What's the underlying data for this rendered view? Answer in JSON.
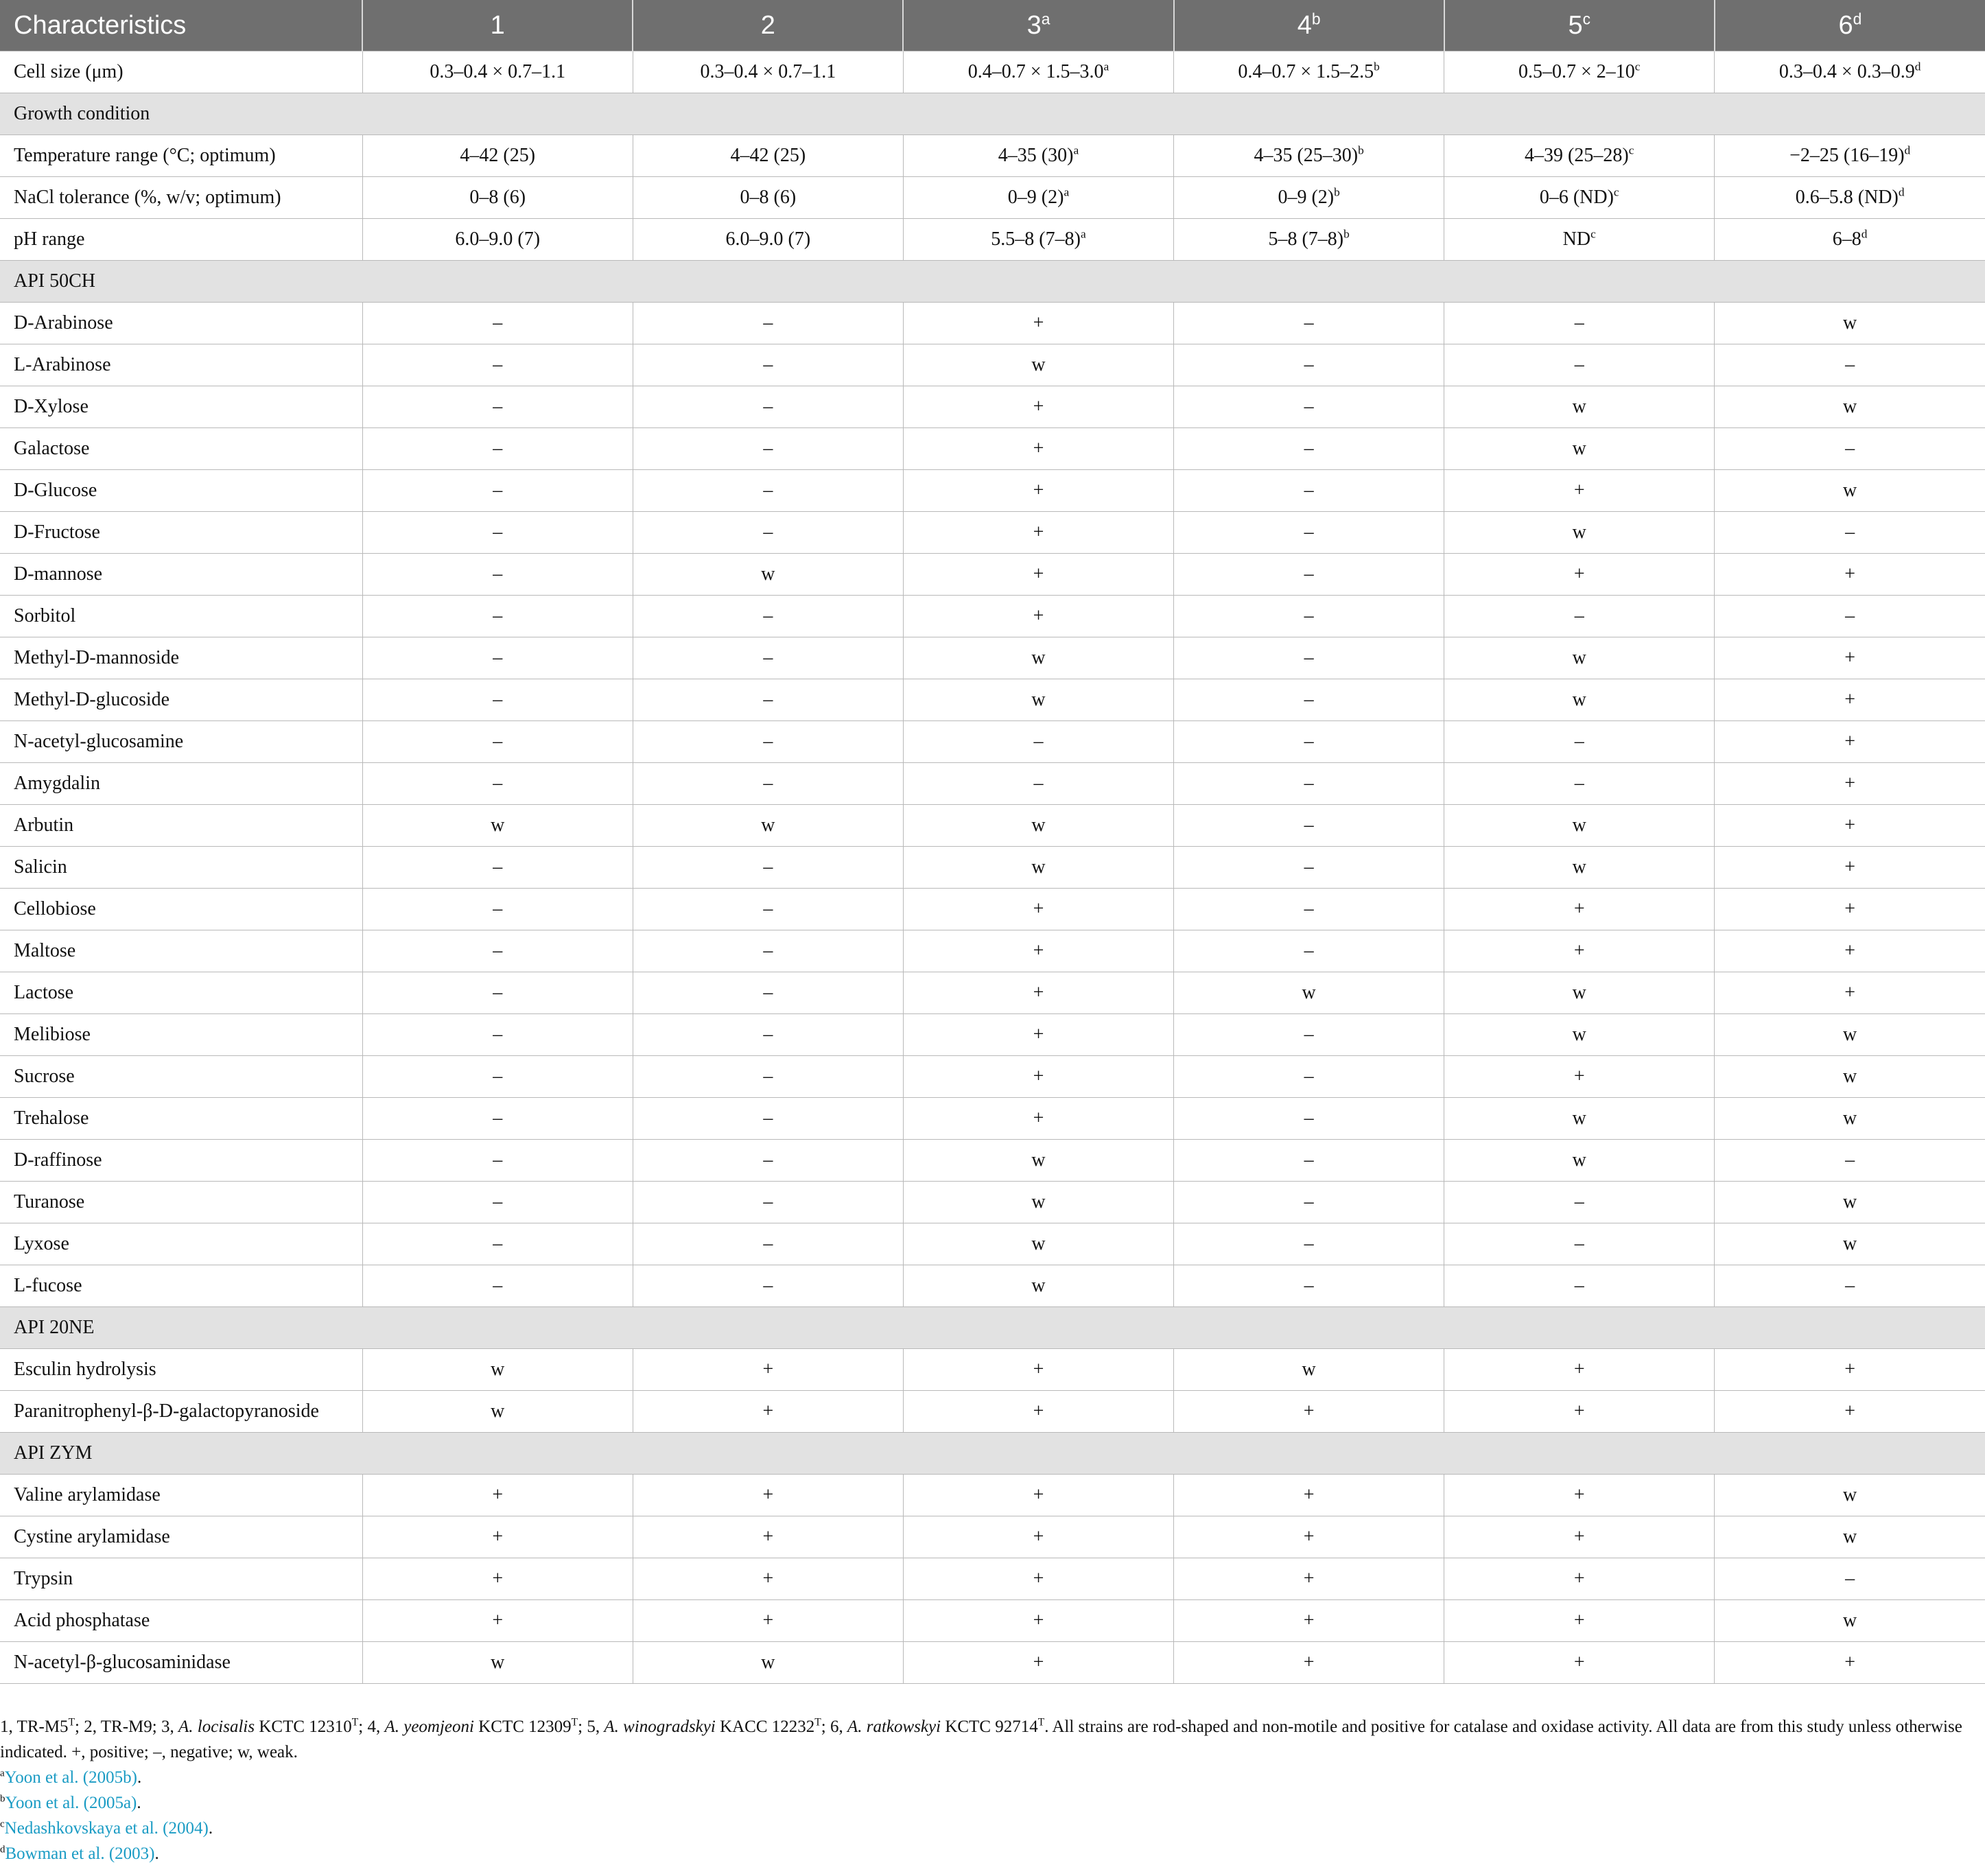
{
  "columns": [
    {
      "label": "Characteristics",
      "sup": ""
    },
    {
      "label": "1",
      "sup": ""
    },
    {
      "label": "2",
      "sup": ""
    },
    {
      "label": "3",
      "sup": "a"
    },
    {
      "label": "4",
      "sup": "b"
    },
    {
      "label": "5",
      "sup": "c"
    },
    {
      "label": "6",
      "sup": "d"
    }
  ],
  "rows": [
    {
      "type": "data",
      "label": "Cell size (μm)",
      "cells": [
        [
          "0.3–0.4 × 0.7–1.1",
          ""
        ],
        [
          "0.3–0.4 × 0.7–1.1",
          ""
        ],
        [
          "0.4–0.7 × 1.5–3.0",
          "a"
        ],
        [
          "0.4–0.7 × 1.5–2.5",
          "b"
        ],
        [
          "0.5–0.7 × 2–10",
          "c"
        ],
        [
          "0.3–0.4 × 0.3–0.9",
          "d"
        ]
      ]
    },
    {
      "type": "section",
      "label": "Growth condition"
    },
    {
      "type": "data",
      "label": "Temperature range (°C; optimum)",
      "cells": [
        [
          "4–42 (25)",
          ""
        ],
        [
          "4–42 (25)",
          ""
        ],
        [
          "4–35 (30)",
          "a"
        ],
        [
          "4–35 (25–30)",
          "b"
        ],
        [
          "4–39 (25–28)",
          "c"
        ],
        [
          "−2–25 (16–19)",
          "d"
        ]
      ]
    },
    {
      "type": "data",
      "label": "NaCl tolerance (%, w/v; optimum)",
      "cells": [
        [
          "0–8 (6)",
          ""
        ],
        [
          "0–8 (6)",
          ""
        ],
        [
          "0–9 (2)",
          "a"
        ],
        [
          "0–9 (2)",
          "b"
        ],
        [
          "0–6 (ND)",
          "c"
        ],
        [
          "0.6–5.8 (ND)",
          "d"
        ]
      ]
    },
    {
      "type": "data",
      "label": "pH range",
      "cells": [
        [
          "6.0–9.0 (7)",
          ""
        ],
        [
          "6.0–9.0 (7)",
          ""
        ],
        [
          "5.5–8 (7–8)",
          "a"
        ],
        [
          "5–8 (7–8)",
          "b"
        ],
        [
          "ND",
          "c"
        ],
        [
          "6–8",
          "d"
        ]
      ]
    },
    {
      "type": "section",
      "label": "API 50CH"
    },
    {
      "type": "data",
      "label": "D-Arabinose",
      "cells": [
        [
          "–",
          ""
        ],
        [
          "–",
          ""
        ],
        [
          "+",
          ""
        ],
        [
          "–",
          ""
        ],
        [
          "–",
          ""
        ],
        [
          "w",
          ""
        ]
      ]
    },
    {
      "type": "data",
      "label": "L-Arabinose",
      "cells": [
        [
          "–",
          ""
        ],
        [
          "–",
          ""
        ],
        [
          "w",
          ""
        ],
        [
          "–",
          ""
        ],
        [
          "–",
          ""
        ],
        [
          "–",
          ""
        ]
      ]
    },
    {
      "type": "data",
      "label": "D-Xylose",
      "cells": [
        [
          "–",
          ""
        ],
        [
          "–",
          ""
        ],
        [
          "+",
          ""
        ],
        [
          "–",
          ""
        ],
        [
          "w",
          ""
        ],
        [
          "w",
          ""
        ]
      ]
    },
    {
      "type": "data",
      "label": "Galactose",
      "cells": [
        [
          "–",
          ""
        ],
        [
          "–",
          ""
        ],
        [
          "+",
          ""
        ],
        [
          "–",
          ""
        ],
        [
          "w",
          ""
        ],
        [
          "–",
          ""
        ]
      ]
    },
    {
      "type": "data",
      "label": "D-Glucose",
      "cells": [
        [
          "–",
          ""
        ],
        [
          "–",
          ""
        ],
        [
          "+",
          ""
        ],
        [
          "–",
          ""
        ],
        [
          "+",
          ""
        ],
        [
          "w",
          ""
        ]
      ]
    },
    {
      "type": "data",
      "label": "D-Fructose",
      "cells": [
        [
          "–",
          ""
        ],
        [
          "–",
          ""
        ],
        [
          "+",
          ""
        ],
        [
          "–",
          ""
        ],
        [
          "w",
          ""
        ],
        [
          "–",
          ""
        ]
      ]
    },
    {
      "type": "data",
      "label": "D-mannose",
      "cells": [
        [
          "–",
          ""
        ],
        [
          "w",
          ""
        ],
        [
          "+",
          ""
        ],
        [
          "–",
          ""
        ],
        [
          "+",
          ""
        ],
        [
          "+",
          ""
        ]
      ]
    },
    {
      "type": "data",
      "label": "Sorbitol",
      "cells": [
        [
          "–",
          ""
        ],
        [
          "–",
          ""
        ],
        [
          "+",
          ""
        ],
        [
          "–",
          ""
        ],
        [
          "–",
          ""
        ],
        [
          "–",
          ""
        ]
      ]
    },
    {
      "type": "data",
      "label": "Methyl-D-mannoside",
      "cells": [
        [
          "–",
          ""
        ],
        [
          "–",
          ""
        ],
        [
          "w",
          ""
        ],
        [
          "–",
          ""
        ],
        [
          "w",
          ""
        ],
        [
          "+",
          ""
        ]
      ]
    },
    {
      "type": "data",
      "label": "Methyl-D-glucoside",
      "cells": [
        [
          "–",
          ""
        ],
        [
          "–",
          ""
        ],
        [
          "w",
          ""
        ],
        [
          "–",
          ""
        ],
        [
          "w",
          ""
        ],
        [
          "+",
          ""
        ]
      ]
    },
    {
      "type": "data",
      "label": "N-acetyl-glucosamine",
      "cells": [
        [
          "–",
          ""
        ],
        [
          "–",
          ""
        ],
        [
          "–",
          ""
        ],
        [
          "–",
          ""
        ],
        [
          "–",
          ""
        ],
        [
          "+",
          ""
        ]
      ]
    },
    {
      "type": "data",
      "label": "Amygdalin",
      "cells": [
        [
          "–",
          ""
        ],
        [
          "–",
          ""
        ],
        [
          "–",
          ""
        ],
        [
          "–",
          ""
        ],
        [
          "–",
          ""
        ],
        [
          "+",
          ""
        ]
      ]
    },
    {
      "type": "data",
      "label": "Arbutin",
      "cells": [
        [
          "w",
          ""
        ],
        [
          "w",
          ""
        ],
        [
          "w",
          ""
        ],
        [
          "–",
          ""
        ],
        [
          "w",
          ""
        ],
        [
          "+",
          ""
        ]
      ]
    },
    {
      "type": "data",
      "label": "Salicin",
      "cells": [
        [
          "–",
          ""
        ],
        [
          "–",
          ""
        ],
        [
          "w",
          ""
        ],
        [
          "–",
          ""
        ],
        [
          "w",
          ""
        ],
        [
          "+",
          ""
        ]
      ]
    },
    {
      "type": "data",
      "label": "Cellobiose",
      "cells": [
        [
          "–",
          ""
        ],
        [
          "–",
          ""
        ],
        [
          "+",
          ""
        ],
        [
          "–",
          ""
        ],
        [
          "+",
          ""
        ],
        [
          "+",
          ""
        ]
      ]
    },
    {
      "type": "data",
      "label": "Maltose",
      "cells": [
        [
          "–",
          ""
        ],
        [
          "–",
          ""
        ],
        [
          "+",
          ""
        ],
        [
          "–",
          ""
        ],
        [
          "+",
          ""
        ],
        [
          "+",
          ""
        ]
      ]
    },
    {
      "type": "data",
      "label": "Lactose",
      "cells": [
        [
          "–",
          ""
        ],
        [
          "–",
          ""
        ],
        [
          "+",
          ""
        ],
        [
          "w",
          ""
        ],
        [
          "w",
          ""
        ],
        [
          "+",
          ""
        ]
      ]
    },
    {
      "type": "data",
      "label": "Melibiose",
      "cells": [
        [
          "–",
          ""
        ],
        [
          "–",
          ""
        ],
        [
          "+",
          ""
        ],
        [
          "–",
          ""
        ],
        [
          "w",
          ""
        ],
        [
          "w",
          ""
        ]
      ]
    },
    {
      "type": "data",
      "label": "Sucrose",
      "cells": [
        [
          "–",
          ""
        ],
        [
          "–",
          ""
        ],
        [
          "+",
          ""
        ],
        [
          "–",
          ""
        ],
        [
          "+",
          ""
        ],
        [
          "w",
          ""
        ]
      ]
    },
    {
      "type": "data",
      "label": "Trehalose",
      "cells": [
        [
          "–",
          ""
        ],
        [
          "–",
          ""
        ],
        [
          "+",
          ""
        ],
        [
          "–",
          ""
        ],
        [
          "w",
          ""
        ],
        [
          "w",
          ""
        ]
      ]
    },
    {
      "type": "data",
      "label": "D-raffinose",
      "cells": [
        [
          "–",
          ""
        ],
        [
          "–",
          ""
        ],
        [
          "w",
          ""
        ],
        [
          "–",
          ""
        ],
        [
          "w",
          ""
        ],
        [
          "–",
          ""
        ]
      ]
    },
    {
      "type": "data",
      "label": "Turanose",
      "cells": [
        [
          "–",
          ""
        ],
        [
          "–",
          ""
        ],
        [
          "w",
          ""
        ],
        [
          "–",
          ""
        ],
        [
          "–",
          ""
        ],
        [
          "w",
          ""
        ]
      ]
    },
    {
      "type": "data",
      "label": "Lyxose",
      "cells": [
        [
          "–",
          ""
        ],
        [
          "–",
          ""
        ],
        [
          "w",
          ""
        ],
        [
          "–",
          ""
        ],
        [
          "–",
          ""
        ],
        [
          "w",
          ""
        ]
      ]
    },
    {
      "type": "data",
      "label": "L-fucose",
      "cells": [
        [
          "–",
          ""
        ],
        [
          "–",
          ""
        ],
        [
          "w",
          ""
        ],
        [
          "–",
          ""
        ],
        [
          "–",
          ""
        ],
        [
          "–",
          ""
        ]
      ]
    },
    {
      "type": "section",
      "label": "API 20NE"
    },
    {
      "type": "data",
      "label": "Esculin hydrolysis",
      "cells": [
        [
          "w",
          ""
        ],
        [
          "+",
          ""
        ],
        [
          "+",
          ""
        ],
        [
          "w",
          ""
        ],
        [
          "+",
          ""
        ],
        [
          "+",
          ""
        ]
      ]
    },
    {
      "type": "data",
      "label": "Paranitrophenyl-β-D-galactopyranoside",
      "cells": [
        [
          "w",
          ""
        ],
        [
          "+",
          ""
        ],
        [
          "+",
          ""
        ],
        [
          "+",
          ""
        ],
        [
          "+",
          ""
        ],
        [
          "+",
          ""
        ]
      ]
    },
    {
      "type": "section",
      "label": "API ZYM"
    },
    {
      "type": "data",
      "label": "Valine arylamidase",
      "cells": [
        [
          "+",
          ""
        ],
        [
          "+",
          ""
        ],
        [
          "+",
          ""
        ],
        [
          "+",
          ""
        ],
        [
          "+",
          ""
        ],
        [
          "w",
          ""
        ]
      ]
    },
    {
      "type": "data",
      "label": "Cystine arylamidase",
      "cells": [
        [
          "+",
          ""
        ],
        [
          "+",
          ""
        ],
        [
          "+",
          ""
        ],
        [
          "+",
          ""
        ],
        [
          "+",
          ""
        ],
        [
          "w",
          ""
        ]
      ]
    },
    {
      "type": "data",
      "label": "Trypsin",
      "cells": [
        [
          "+",
          ""
        ],
        [
          "+",
          ""
        ],
        [
          "+",
          ""
        ],
        [
          "+",
          ""
        ],
        [
          "+",
          ""
        ],
        [
          "–",
          ""
        ]
      ]
    },
    {
      "type": "data",
      "label": "Acid phosphatase",
      "cells": [
        [
          "+",
          ""
        ],
        [
          "+",
          ""
        ],
        [
          "+",
          ""
        ],
        [
          "+",
          ""
        ],
        [
          "+",
          ""
        ],
        [
          "w",
          ""
        ]
      ]
    },
    {
      "type": "data",
      "label": "N-acetyl-β-glucosaminidase",
      "cells": [
        [
          "w",
          ""
        ],
        [
          "w",
          ""
        ],
        [
          "+",
          ""
        ],
        [
          "+",
          ""
        ],
        [
          "+",
          ""
        ],
        [
          "+",
          ""
        ]
      ]
    }
  ],
  "footnote": {
    "segments": [
      {
        "text": "1, TR-M5",
        "style": "normal"
      },
      {
        "text": "T",
        "style": "sup"
      },
      {
        "text": "; 2, TR-M9; 3, ",
        "style": "normal"
      },
      {
        "text": "A. locisalis",
        "style": "italic"
      },
      {
        "text": " KCTC 12310",
        "style": "normal"
      },
      {
        "text": "T",
        "style": "sup"
      },
      {
        "text": "; 4, ",
        "style": "normal"
      },
      {
        "text": "A. yeomjeoni",
        "style": "italic"
      },
      {
        "text": " KCTC 12309",
        "style": "normal"
      },
      {
        "text": "T",
        "style": "sup"
      },
      {
        "text": "; 5, ",
        "style": "normal"
      },
      {
        "text": "A. winogradskyi",
        "style": "italic"
      },
      {
        "text": " KACC 12232",
        "style": "normal"
      },
      {
        "text": "T",
        "style": "sup"
      },
      {
        "text": "; 6, ",
        "style": "normal"
      },
      {
        "text": "A. ratkowskyi",
        "style": "italic"
      },
      {
        "text": " KCTC 92714",
        "style": "normal"
      },
      {
        "text": "T",
        "style": "sup"
      },
      {
        "text": ". All strains are rod-shaped and non-motile and positive for catalase and oxidase activity. All data are from this study unless otherwise indicated. +, positive; –, negative; w, weak.",
        "style": "normal"
      }
    ],
    "references": [
      {
        "mark": "a",
        "text": "Yoon et al. (2005b)",
        "suffix": "."
      },
      {
        "mark": "b",
        "text": "Yoon et al. (2005a)",
        "suffix": "."
      },
      {
        "mark": "c",
        "text": "Nedashkovskaya et al. (2004)",
        "suffix": "."
      },
      {
        "mark": "d",
        "text": "Bowman et al. (2003)",
        "suffix": "."
      }
    ]
  },
  "colors": {
    "header_bg": "#6f6f6f",
    "section_bg": "#e2e2e2",
    "link": "#1a9bc4",
    "grid": "#b9b9b9"
  }
}
